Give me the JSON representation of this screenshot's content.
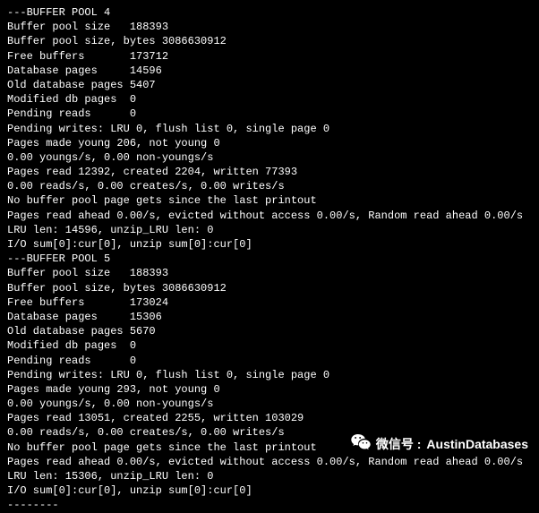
{
  "pools": [
    {
      "header": "---BUFFER POOL 4",
      "lines": [
        "Buffer pool size   188393",
        "Buffer pool size, bytes 3086630912",
        "Free buffers       173712",
        "Database pages     14596",
        "Old database pages 5407",
        "Modified db pages  0",
        "Pending reads      0",
        "Pending writes: LRU 0, flush list 0, single page 0",
        "Pages made young 206, not young 0",
        "0.00 youngs/s, 0.00 non-youngs/s",
        "Pages read 12392, created 2204, written 77393",
        "0.00 reads/s, 0.00 creates/s, 0.00 writes/s",
        "No buffer pool page gets since the last printout",
        "Pages read ahead 0.00/s, evicted without access 0.00/s, Random read ahead 0.00/s",
        "LRU len: 14596, unzip_LRU len: 0",
        "I/O sum[0]:cur[0], unzip sum[0]:cur[0]"
      ]
    },
    {
      "header": "---BUFFER POOL 5",
      "lines": [
        "Buffer pool size   188393",
        "Buffer pool size, bytes 3086630912",
        "Free buffers       173024",
        "Database pages     15306",
        "Old database pages 5670",
        "Modified db pages  0",
        "Pending reads      0",
        "Pending writes: LRU 0, flush list 0, single page 0",
        "Pages made young 293, not young 0",
        "0.00 youngs/s, 0.00 non-youngs/s",
        "Pages read 13051, created 2255, written 103029",
        "0.00 reads/s, 0.00 creates/s, 0.00 writes/s",
        "No buffer pool page gets since the last printout",
        "Pages read ahead 0.00/s, evicted without access 0.00/s, Random read ahead 0.00/s",
        "LRU len: 15306, unzip_LRU len: 0",
        "I/O sum[0]:cur[0], unzip sum[0]:cur[0]"
      ]
    }
  ],
  "trailing_dashes": "--------",
  "watermark": {
    "label": "微信号 :",
    "value": "AustinDatabases"
  }
}
